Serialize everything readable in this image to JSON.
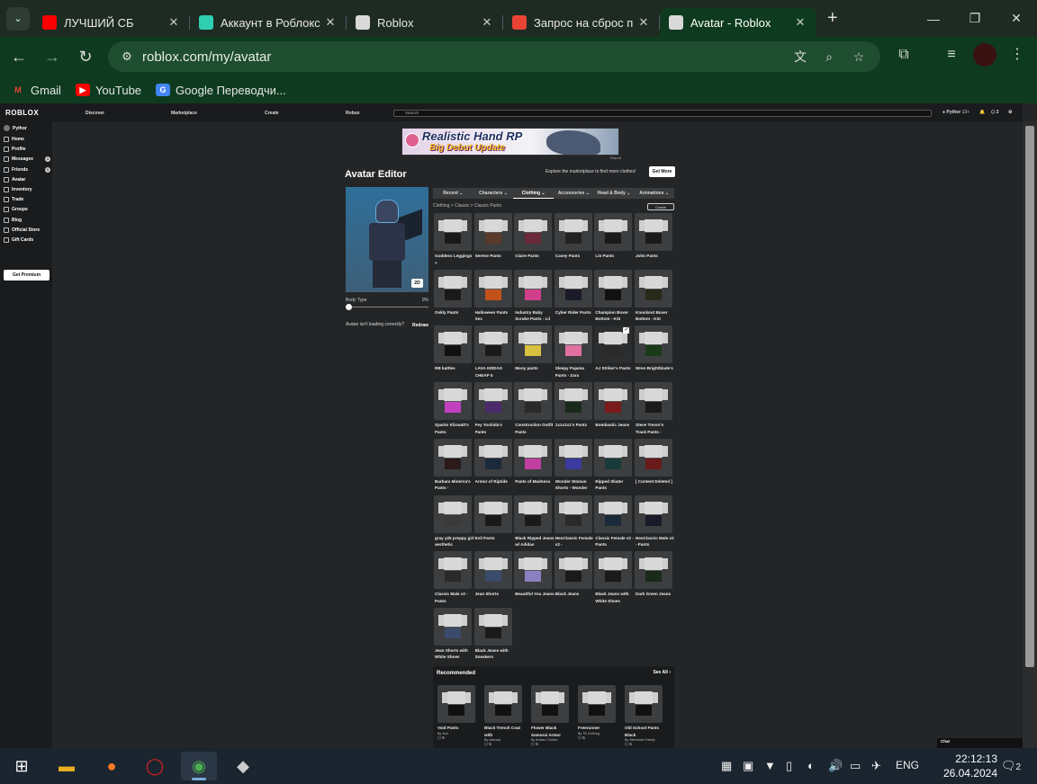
{
  "browser": {
    "tabs": [
      {
        "title": "ЛУЧШИЙ СБ",
        "icon": "youtube-icon",
        "color": "#ff0000",
        "active": false
      },
      {
        "title": "Аккаунт в Роблокс с",
        "icon": "chat-icon",
        "color": "#2ecfb0",
        "active": false
      },
      {
        "title": "Roblox",
        "icon": "roblox-icon",
        "color": "#d9d9d9",
        "active": false
      },
      {
        "title": "Запрос на сброс па",
        "icon": "gmail-icon",
        "color": "#ea4335",
        "active": false
      },
      {
        "title": "Avatar - Roblox",
        "icon": "roblox-icon",
        "color": "#d9d9d9",
        "active": true
      }
    ],
    "url": "roblox.com/my/avatar",
    "bookmarks": [
      {
        "label": "Gmail",
        "icon": "gmail-icon"
      },
      {
        "label": "YouTube",
        "icon": "youtube-icon"
      },
      {
        "label": "Google Переводчи...",
        "icon": "translate-icon"
      }
    ],
    "theme_color": "#0e3b1f"
  },
  "roblox": {
    "logo": "ROBLOX",
    "nav": [
      "Discover",
      "Marketplace",
      "Create",
      "Robux"
    ],
    "search_placeholder": "Search",
    "username": "Pythor",
    "age_tag": "13+",
    "robux": "2",
    "sidebar": {
      "user": "Pythor",
      "items": [
        {
          "label": "Home",
          "icon": "home-icon",
          "badge": ""
        },
        {
          "label": "Profile",
          "icon": "profile-icon",
          "badge": ""
        },
        {
          "label": "Messages",
          "icon": "messages-icon",
          "badge": "1"
        },
        {
          "label": "Friends",
          "icon": "friends-icon",
          "badge": "1"
        },
        {
          "label": "Avatar",
          "icon": "avatar-icon",
          "badge": ""
        },
        {
          "label": "Inventory",
          "icon": "inventory-icon",
          "badge": ""
        },
        {
          "label": "Trade",
          "icon": "trade-icon",
          "badge": ""
        },
        {
          "label": "Groups",
          "icon": "groups-icon",
          "badge": ""
        },
        {
          "label": "Blog",
          "icon": "blog-icon",
          "badge": ""
        },
        {
          "label": "Official Store",
          "icon": "store-icon",
          "badge": ""
        },
        {
          "label": "Gift Cards",
          "icon": "giftcard-icon",
          "badge": ""
        }
      ],
      "premium_label": "Get Premium"
    },
    "ad": {
      "line1": "Realistic Hand RP",
      "line2": "Big Debut Update",
      "report": "Report"
    },
    "editor": {
      "title": "Avatar Editor",
      "explore_text": "Explore the marketplace to find more clothes!",
      "get_more": "Get More",
      "view_button": "2D",
      "body_type_label": "Body Type",
      "body_type_value": "0%",
      "body_type_level": 0,
      "not_loading": "Avatar isn't loading correctly?",
      "redraw": "Redraw",
      "tabs": [
        {
          "label": "Recent",
          "active": false
        },
        {
          "label": "Characters",
          "active": false
        },
        {
          "label": "Clothing",
          "active": true
        },
        {
          "label": "Accessories",
          "active": false
        },
        {
          "label": "Head & Body",
          "active": false
        },
        {
          "label": "Animations",
          "active": false
        }
      ],
      "breadcrumb": "Clothing > Classic > Classic Pants",
      "create_button": "Create",
      "items": [
        {
          "name": "Goddess Leggings +",
          "color": "#1a1a1a",
          "selected": false
        },
        {
          "name": "Serene Pants",
          "color": "#5a3a2a",
          "selected": false
        },
        {
          "name": "Claire Pants",
          "color": "#6a2a3a",
          "selected": false
        },
        {
          "name": "Casey Pants",
          "color": "#222222",
          "selected": false
        },
        {
          "name": "Lin Pants",
          "color": "#1a1a1a",
          "selected": false
        },
        {
          "name": "John Pants",
          "color": "#1a1a1a",
          "selected": false
        },
        {
          "name": "Oskly Pants",
          "color": "#1a1a1a",
          "selected": false
        },
        {
          "name": "Halloween Pants Xex",
          "color": "#c2521a",
          "selected": false
        },
        {
          "name": "Industry Baby Scrube Pants - Lil",
          "color": "#d0408a",
          "selected": false
        },
        {
          "name": "Cyber Rider Pants",
          "color": "#1a1a2a",
          "selected": false
        },
        {
          "name": "Champion Boxer Bottom - KSI",
          "color": "#111111",
          "selected": false
        },
        {
          "name": "Knockout Boxer Bottom - KSI",
          "color": "#2a2a1a",
          "selected": false
        },
        {
          "name": "RB battles",
          "color": "#111111",
          "selected": false
        },
        {
          "name": "LAVA ADIDAS CHEAP 5",
          "color": "#1a1a1a",
          "selected": false
        },
        {
          "name": "Mony pants",
          "color": "#d8c040",
          "selected": false
        },
        {
          "name": "Sleepy Pajama Pants - Zara",
          "color": "#e070a0",
          "selected": false
        },
        {
          "name": "AJ Striker's Pants",
          "color": "#2a2a2a",
          "selected": true
        },
        {
          "name": "Wren Brightblade's",
          "color": "#1a3a1a",
          "selected": false
        },
        {
          "name": "Sparks Klicwatt's Pants",
          "color": "#c040c0",
          "selected": false
        },
        {
          "name": "Fey Yoshida's Pants",
          "color": "#4a2a6a",
          "selected": false
        },
        {
          "name": "Construction Outfit Pants",
          "color": "#2a2a2a",
          "selected": false
        },
        {
          "name": "1x1x1x1's Pants",
          "color": "#1a2a1a",
          "selected": false
        },
        {
          "name": "Bombastic Jeans",
          "color": "#7a1a1a",
          "selected": false
        },
        {
          "name": "Steve Trevor's Track Pants -",
          "color": "#1a1a1a",
          "selected": false
        },
        {
          "name": "Barbara Minerva's Pants -",
          "color": "#2a1a1a",
          "selected": false
        },
        {
          "name": "Armor of Riptide",
          "color": "#1a2a3a",
          "selected": false
        },
        {
          "name": "Pants of Madness",
          "color": "#c040a0",
          "selected": false
        },
        {
          "name": "Wonder Woman Shorts - Wonder",
          "color": "#3a3aa0",
          "selected": false
        },
        {
          "name": "Ripped Skater Pants",
          "color": "#1a3a3a",
          "selected": false
        },
        {
          "name": "[ Content Deleted ]",
          "color": "#6a1a1a",
          "selected": false
        },
        {
          "name": "gray y2k preppy girl aesthetic",
          "color": "#3a3a3a",
          "selected": false
        },
        {
          "name": "Evil Pants",
          "color": "#1a1a1a",
          "selected": false
        },
        {
          "name": "Black Ripped Jeans w/ Adidas",
          "color": "#1a1a1a",
          "selected": false
        },
        {
          "name": "NeoClassic Female v2 -",
          "color": "#2a2a2a",
          "selected": false
        },
        {
          "name": "Classic Female v2 - Pants",
          "color": "#1a2a3a",
          "selected": false
        },
        {
          "name": "NeoClassic Male v2 - Pants",
          "color": "#1a1a2a",
          "selected": false
        },
        {
          "name": "Classic Male v2 - Pants",
          "color": "#2a2a2a",
          "selected": false
        },
        {
          "name": "Jean Shorts",
          "color": "#3a4a6a",
          "selected": false
        },
        {
          "name": "Beautiful You Jeans",
          "color": "#8a80c0",
          "selected": false
        },
        {
          "name": "Black Jeans",
          "color": "#1a1a1a",
          "selected": false
        },
        {
          "name": "Black Jeans with White Shoes",
          "color": "#1a1a1a",
          "selected": false
        },
        {
          "name": "Dark Green Jeans",
          "color": "#1a2a1a",
          "selected": false
        },
        {
          "name": "Jean Shorts with White Shoes",
          "color": "#3a4a6a",
          "selected": false
        },
        {
          "name": "Black Jeans with Sneakers",
          "color": "#1a1a1a",
          "selected": false
        }
      ],
      "recommended": {
        "title": "Recommended",
        "see_all": "See All",
        "items": [
          {
            "name": "Void Pants",
            "by": "By 4sol",
            "price": "5",
            "color": "#111111"
          },
          {
            "name": "Black Trench Coat with",
            "by": "By ukisuow",
            "price": "5",
            "color": "#111111"
          },
          {
            "name": "Flower Black Samurai Armor",
            "by": "By Artisan Clothes",
            "price": "5",
            "color": "#111111"
          },
          {
            "name": "Freerunner",
            "by": "By TB Clothing",
            "price": "5",
            "color": "#111111"
          },
          {
            "name": "Old School Pants Black",
            "by": "By Silversider Family",
            "price": "5",
            "color": "#111111"
          }
        ]
      }
    },
    "chat_label": "Chat"
  },
  "taskbar": {
    "lang": "ENG",
    "time": "22:12:13",
    "date": "26.04.2024",
    "notifications": "2"
  }
}
